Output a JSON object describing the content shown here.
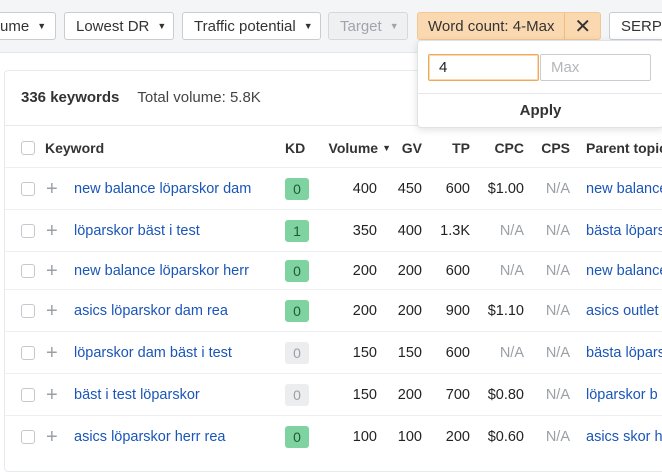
{
  "filters": {
    "volume_partial": "ume",
    "lowest_dr": "Lowest DR",
    "traffic_potential": "Traffic potential",
    "target": "Target",
    "word_count": "Word count: 4-Max",
    "serp_partial": "SERP"
  },
  "popover": {
    "min_value": "4",
    "max_placeholder": "Max",
    "apply_label": "Apply"
  },
  "summary": {
    "keywords_count": "336 keywords",
    "total_volume": "Total volume: 5.8K"
  },
  "table": {
    "columns": {
      "keyword": "Keyword",
      "kd": "KD",
      "volume": "Volume",
      "gv": "GV",
      "tp": "TP",
      "cpc": "CPC",
      "cps": "CPS",
      "parent_topic": "Parent topic"
    },
    "rows": [
      {
        "keyword": "new balance löparskor dam",
        "kd": "0",
        "kd_color": "green",
        "volume": "400",
        "gv": "450",
        "tp": "600",
        "cpc": "$1.00",
        "cps": "N/A",
        "parent": "new balance"
      },
      {
        "keyword": "löparskor bäst i test",
        "kd": "1",
        "kd_color": "green",
        "volume": "350",
        "gv": "400",
        "tp": "1.3K",
        "cpc": "N/A",
        "cps": "N/A",
        "parent": "bästa löpars"
      },
      {
        "keyword": "new balance löparskor herr",
        "kd": "0",
        "kd_color": "green",
        "volume": "200",
        "gv": "200",
        "tp": "600",
        "cpc": "N/A",
        "cps": "N/A",
        "parent": "new balance"
      },
      {
        "keyword": "asics löparskor dam rea",
        "kd": "0",
        "kd_color": "green",
        "volume": "200",
        "gv": "200",
        "tp": "900",
        "cpc": "$1.10",
        "cps": "N/A",
        "parent": "asics outlet"
      },
      {
        "keyword": "löparskor dam bäst i test",
        "kd": "0",
        "kd_color": "grey",
        "volume": "150",
        "gv": "150",
        "tp": "600",
        "cpc": "N/A",
        "cps": "N/A",
        "parent": "bästa löpars"
      },
      {
        "keyword": "bäst i test löparskor",
        "kd": "0",
        "kd_color": "grey",
        "volume": "150",
        "gv": "200",
        "tp": "700",
        "cpc": "$0.80",
        "cps": "N/A",
        "parent": "löparskor b"
      },
      {
        "keyword": "asics löparskor herr rea",
        "kd": "0",
        "kd_color": "green",
        "volume": "100",
        "gv": "100",
        "tp": "200",
        "cpc": "$0.60",
        "cps": "N/A",
        "parent": "asics skor h"
      }
    ]
  },
  "colors": {
    "link": "#1a56b8",
    "kd_green": "#7fd3a0",
    "active_filter": "#fbd9b0"
  }
}
